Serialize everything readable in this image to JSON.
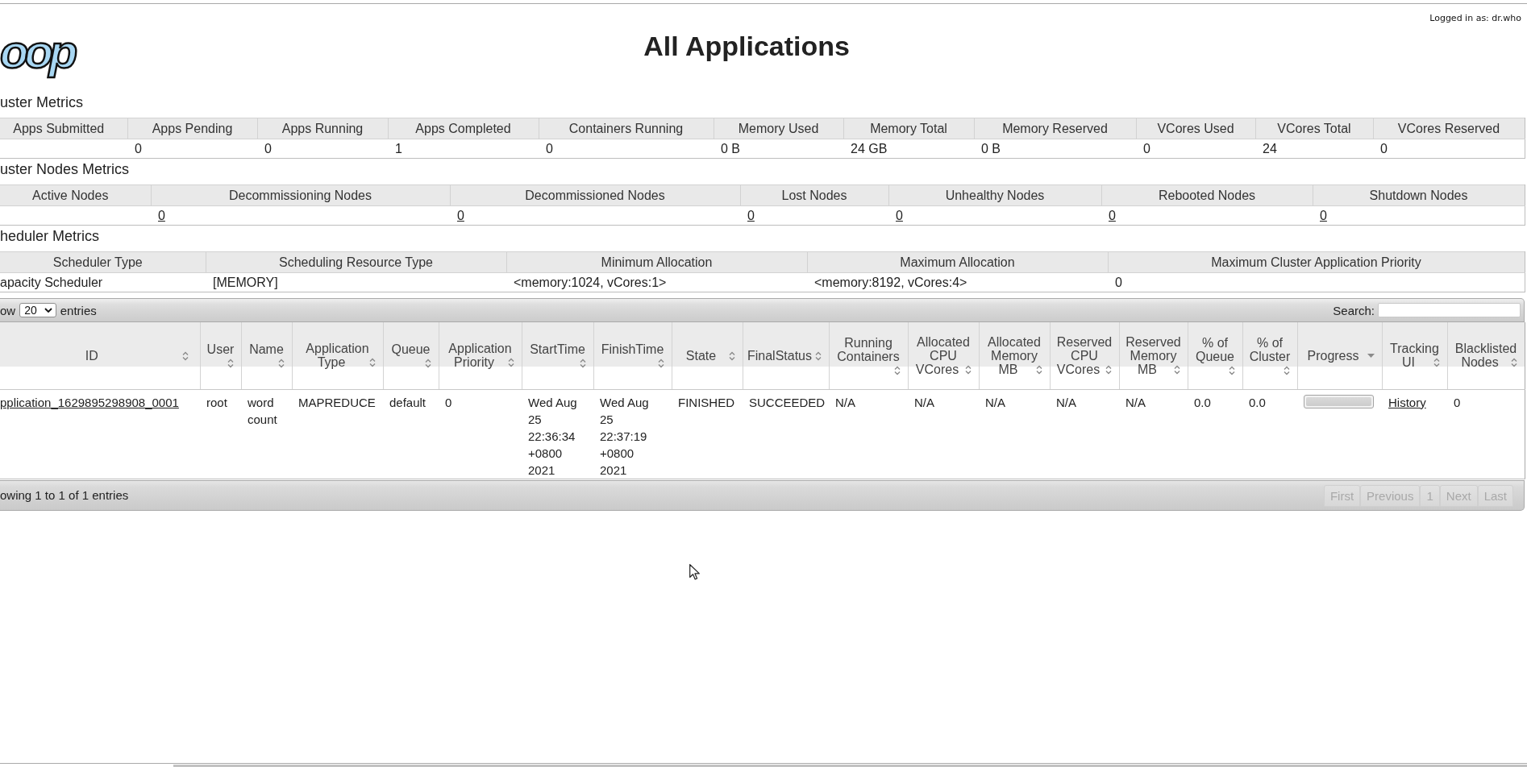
{
  "header": {
    "logo": "oop",
    "title": "All Applications",
    "login": "Logged in as: dr.who"
  },
  "cluster_metrics": {
    "title": "uster Metrics",
    "columns": [
      {
        "header": "Apps Submitted"
      },
      {
        "header": "Apps Pending",
        "value": "0"
      },
      {
        "header": "Apps Running",
        "value": "0"
      },
      {
        "header": "Apps Completed",
        "value": "1"
      },
      {
        "header": "Containers Running",
        "value": "0"
      },
      {
        "header": "Memory Used",
        "value": "0 B"
      },
      {
        "header": "Memory Total",
        "value": "24 GB"
      },
      {
        "header": "Memory Reserved",
        "value": "0 B"
      },
      {
        "header": "VCores Used",
        "value": "0"
      },
      {
        "header": "VCores Total",
        "value": "24"
      },
      {
        "header": "VCores Reserved",
        "value": "0"
      }
    ]
  },
  "cluster_nodes_metrics": {
    "title": "uster Nodes Metrics",
    "columns": [
      {
        "header": "Active Nodes"
      },
      {
        "header": "Decommissioning Nodes",
        "value": "0",
        "value_link": true
      },
      {
        "header": "Decommissioned Nodes",
        "value": "0",
        "value_link": true
      },
      {
        "header": "Lost Nodes",
        "value": "0",
        "value_link": true
      },
      {
        "header": "Unhealthy Nodes",
        "value": "0",
        "value_link": true
      },
      {
        "header": "Rebooted Nodes",
        "value": "0",
        "value_link": true
      },
      {
        "header": "Shutdown Nodes",
        "value": "0",
        "value_link": true
      }
    ]
  },
  "scheduler_metrics": {
    "title": "heduler Metrics",
    "columns": [
      {
        "header": "Scheduler Type",
        "value": "apacity Scheduler"
      },
      {
        "header": "Scheduling Resource Type",
        "value": "[MEMORY]"
      },
      {
        "header": "Minimum Allocation",
        "value": "<memory:1024, vCores:1>"
      },
      {
        "header": "Maximum Allocation",
        "value": "<memory:8192, vCores:4>"
      },
      {
        "header": "Maximum Cluster Application Priority",
        "value": "0"
      }
    ]
  },
  "applications": {
    "length_menu": {
      "prefix": "ow",
      "value": "20",
      "suffix": "entries"
    },
    "search": {
      "label": "Search:"
    },
    "columns": [
      {
        "label": "ID",
        "sorted": false
      },
      {
        "label": "User",
        "sorted": false
      },
      {
        "label": "Name",
        "sorted": false
      },
      {
        "label": "Application Type",
        "sorted": false
      },
      {
        "label": "Queue",
        "sorted": false
      },
      {
        "label": "Application Priority",
        "sorted": false
      },
      {
        "label": "StartTime",
        "sorted": false
      },
      {
        "label": "FinishTime",
        "sorted": false
      },
      {
        "label": "State",
        "sorted": false
      },
      {
        "label": "FinalStatus",
        "sorted": false
      },
      {
        "label": "Running Containers",
        "sorted": false
      },
      {
        "label": "Allocated CPU VCores",
        "sorted": false
      },
      {
        "label": "Allocated Memory MB",
        "sorted": false
      },
      {
        "label": "Reserved CPU VCores",
        "sorted": false
      },
      {
        "label": "Reserved Memory MB",
        "sorted": false
      },
      {
        "label": "% of Queue",
        "sorted": false
      },
      {
        "label": "% of Cluster",
        "sorted": false
      },
      {
        "label": "Progress",
        "sorted": true
      },
      {
        "label": "Tracking UI",
        "sorted": false
      },
      {
        "label": "Blacklisted Nodes",
        "sorted": false
      }
    ],
    "rows": [
      {
        "cells": [
          {
            "kind": "link",
            "text": "pplication_1629895298908_0001"
          },
          {
            "kind": "text",
            "text": "root"
          },
          {
            "kind": "text",
            "text": "word count"
          },
          {
            "kind": "text",
            "text": "MAPREDUCE"
          },
          {
            "kind": "text",
            "text": "default"
          },
          {
            "kind": "text",
            "text": "0"
          },
          {
            "kind": "text",
            "text": "Wed Aug 25 22:36:34 +0800 2021"
          },
          {
            "kind": "text",
            "text": "Wed Aug 25 22:37:19 +0800 2021"
          },
          {
            "kind": "text",
            "text": "FINISHED"
          },
          {
            "kind": "text",
            "text": "SUCCEEDED"
          },
          {
            "kind": "text",
            "text": "N/A"
          },
          {
            "kind": "text",
            "text": "N/A"
          },
          {
            "kind": "text",
            "text": "N/A"
          },
          {
            "kind": "text",
            "text": "N/A"
          },
          {
            "kind": "text",
            "text": "N/A"
          },
          {
            "kind": "text",
            "text": "0.0"
          },
          {
            "kind": "text",
            "text": "0.0"
          },
          {
            "kind": "progress",
            "level": 1
          },
          {
            "kind": "link",
            "text": "History"
          },
          {
            "kind": "text",
            "text": "0"
          }
        ]
      }
    ],
    "info": "owing 1 to 1 of 1 entries",
    "pagination": [
      {
        "label": "First",
        "disabled": true
      },
      {
        "label": "Previous",
        "disabled": true
      },
      {
        "label": "1",
        "disabled": true
      },
      {
        "label": "Next",
        "disabled": true
      },
      {
        "label": "Last",
        "disabled": true
      }
    ]
  }
}
